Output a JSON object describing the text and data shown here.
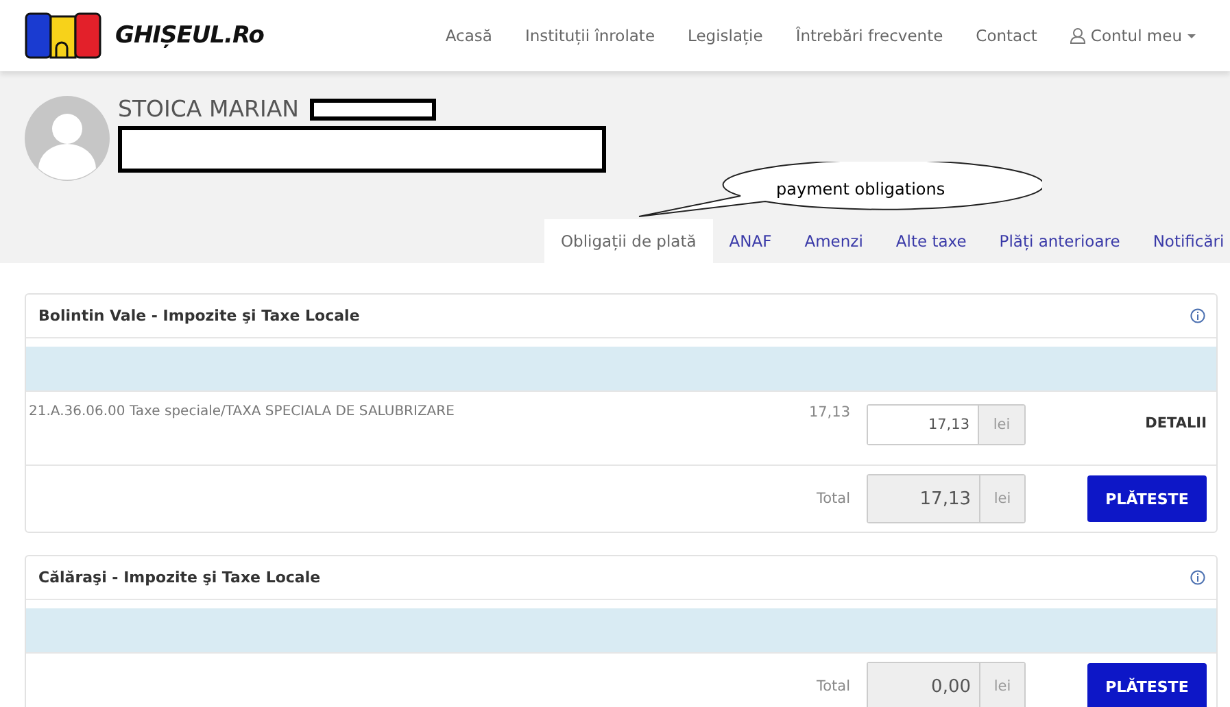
{
  "header": {
    "logo_text": "GHIȘEUL.Ro",
    "nav": [
      "Acasă",
      "Instituții înrolate",
      "Legislație",
      "Întrebări frecvente",
      "Contact"
    ],
    "account": "Contul meu"
  },
  "profile": {
    "name": "STOICA MARIAN"
  },
  "callout": "payment obligations",
  "tabs": [
    {
      "label": "Obligații de plată",
      "selected": true
    },
    {
      "label": "ANAF",
      "selected": false
    },
    {
      "label": "Amenzi",
      "selected": false
    },
    {
      "label": "Alte taxe",
      "selected": false
    },
    {
      "label": "Plăți anterioare",
      "selected": false
    },
    {
      "label": "Notificări",
      "selected": false
    }
  ],
  "cards": [
    {
      "title": "Bolintin Vale - Impozite şi Taxe Locale",
      "items": [
        {
          "description": "21.A.36.06.00 Taxe speciale/TAXA SPECIALA DE SALUBRIZARE",
          "amount": "17,13",
          "value": "17,13",
          "currency": "lei",
          "action": "DETALII"
        }
      ],
      "total": {
        "label": "Total",
        "value": "17,13",
        "currency": "lei"
      },
      "pay_button": "PLĂTESTE"
    },
    {
      "title": "Călăraşi - Impozite şi Taxe Locale",
      "total": {
        "label": "Total",
        "value": "0,00",
        "currency": "lei"
      },
      "pay_button": "PLĂTESTE"
    }
  ]
}
